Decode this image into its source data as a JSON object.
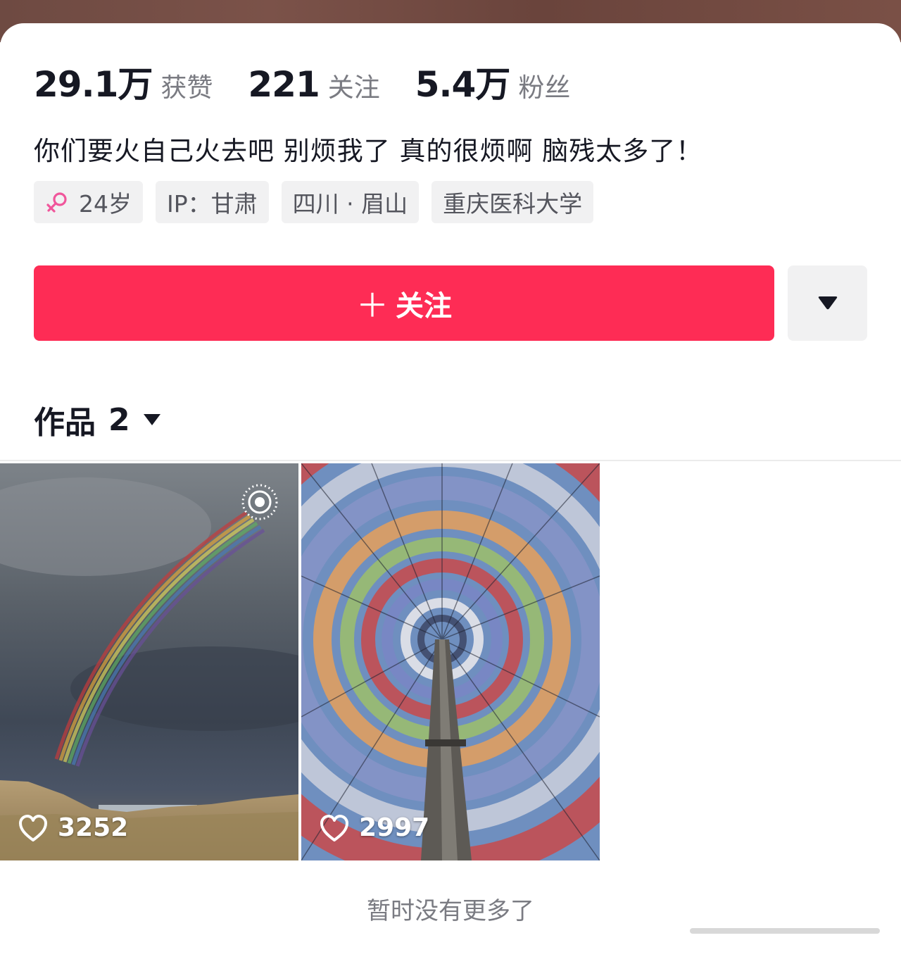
{
  "stats": [
    {
      "value": "29.1万",
      "label": "获赞"
    },
    {
      "value": "221",
      "label": "关注"
    },
    {
      "value": "5.4万",
      "label": "粉丝"
    }
  ],
  "bio": "你们要火自己火去吧 别烦我了 真的很烦啊 脑残太多了！",
  "tags": {
    "gender_icon": "female-icon",
    "age": "24岁",
    "ip": "IP：甘肃",
    "location": "四川 · 眉山",
    "school": "重庆医科大学"
  },
  "actions": {
    "follow_label": "关注",
    "follow_icon": "plus-icon",
    "more_icon": "caret-down-icon"
  },
  "works": {
    "title": "作品",
    "count": "2",
    "videos": [
      {
        "likes": "3252",
        "badge_icon": "live-photo-icon"
      },
      {
        "likes": "2997"
      }
    ]
  },
  "footer": {
    "no_more_text": "暂时没有更多了"
  },
  "colors": {
    "accent": "#fe2c55",
    "tag_bg": "#f1f1f2",
    "female_pink": "#f0569b"
  }
}
